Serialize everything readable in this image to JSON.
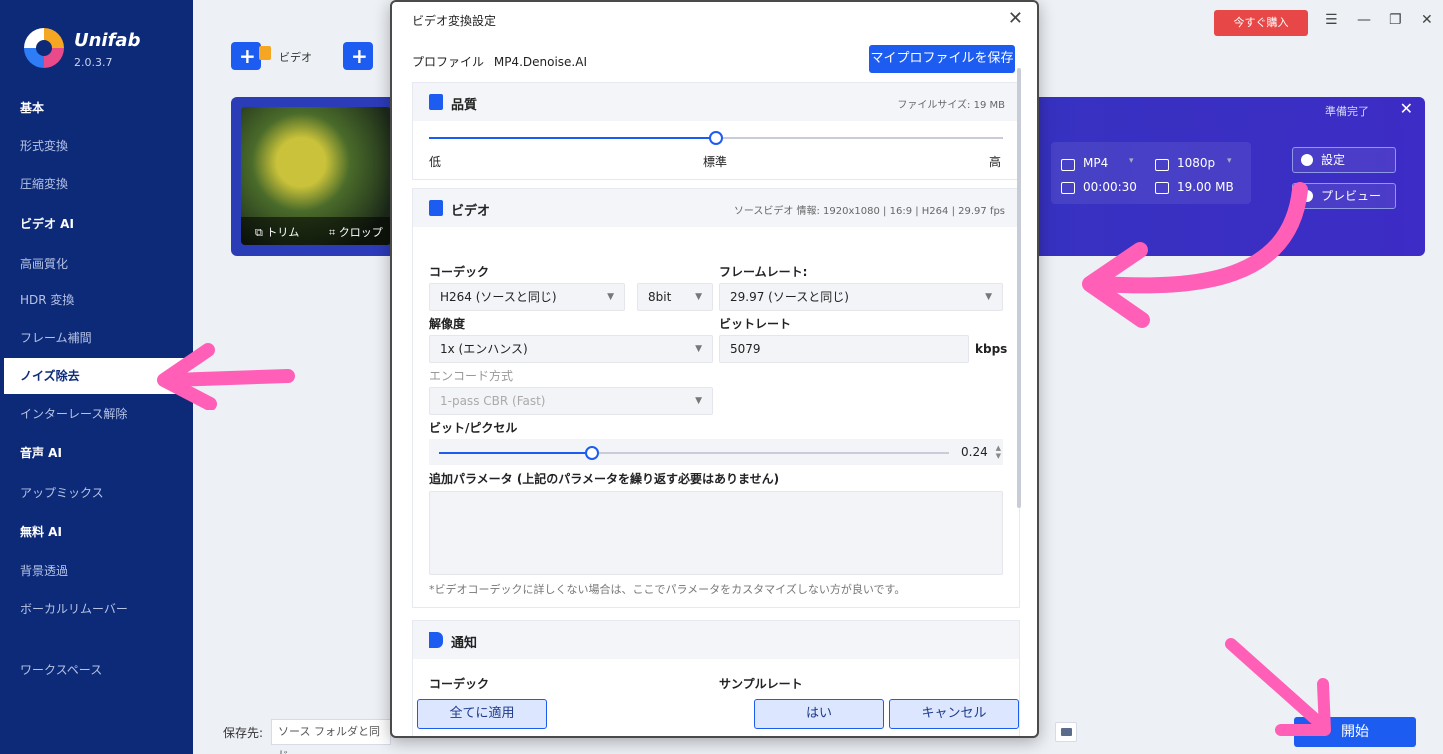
{
  "app": {
    "name": "Unifab",
    "version": "2.0.3.7"
  },
  "sidebar": {
    "items": [
      {
        "label": "基本",
        "kind": "header"
      },
      {
        "label": "形式変換",
        "kind": "item"
      },
      {
        "label": "圧縮変換",
        "kind": "item"
      },
      {
        "label": "ビデオ AI",
        "kind": "header"
      },
      {
        "label": "高画質化",
        "kind": "item"
      },
      {
        "label": "HDR 変換",
        "kind": "item"
      },
      {
        "label": "フレーム補間",
        "kind": "item"
      },
      {
        "label": "ノイズ除去",
        "kind": "active"
      },
      {
        "label": "インターレース解除",
        "kind": "item"
      },
      {
        "label": "音声 AI",
        "kind": "header"
      },
      {
        "label": "アップミックス",
        "kind": "item"
      },
      {
        "label": "無料 AI",
        "kind": "header"
      },
      {
        "label": "背景透過",
        "kind": "item"
      },
      {
        "label": "ボーカルリムーバー",
        "kind": "item"
      },
      {
        "label": "ワークスペース",
        "kind": "item"
      }
    ]
  },
  "toolbar": {
    "add_video_label": "ビデオ",
    "buy_label": "今すぐ購入"
  },
  "task": {
    "status": "準備完了",
    "trim_label": "トリム",
    "crop_label": "クロップ",
    "format": "MP4",
    "resolution": "1080p",
    "duration": "00:00:30",
    "size": "19.00 MB",
    "settings_label": "設定",
    "preview_label": "プレビュー"
  },
  "bottom": {
    "save_label": "保存先:",
    "save_path": "ソース フォルダと同じ",
    "start_label": "開始"
  },
  "dialog": {
    "title": "ビデオ変換設定",
    "profile_label": "プロファイル",
    "profile_value": "MP4.Denoise.AI",
    "save_profile_label": "マイプロファイルを保存",
    "quality": {
      "title": "品質",
      "file_size": "ファイルサイズ:  19 MB",
      "low": "低",
      "standard": "標準",
      "high": "高",
      "level": 0.5
    },
    "video": {
      "title": "ビデオ",
      "source_info": "ソースビデオ 情報: 1920x1080 | 16:9 | H264 | 29.97 fps",
      "codec_label": "コーデック",
      "codec_value": "H264 (ソースと同じ)",
      "bitdepth_value": "8bit",
      "framerate_label": "フレームレート:",
      "framerate_value": "29.97 (ソースと同じ)",
      "resolution_label": "解像度",
      "resolution_value": "1x (エンハンス)",
      "bitrate_label": "ビットレート",
      "bitrate_value": "5079",
      "bitrate_unit": "kbps",
      "encode_label": "エンコード方式",
      "encode_value": "1-pass CBR (Fast)",
      "bpp_label": "ビット/ピクセル",
      "bpp_value": "0.24",
      "bpp_level": 0.3,
      "extra_label": "追加パラメータ (上記のパラメータを繰り返す必要はありません)",
      "hint": "*ビデオコーデックに詳しくない場合は、ここでパラメータをカスタマイズしない方が良いです。"
    },
    "audio": {
      "title": "通知",
      "codec_label": "コーデック",
      "samplerate_label": "サンプルレート"
    },
    "apply_all_label": "全てに適用",
    "ok_label": "はい",
    "cancel_label": "キャンセル"
  },
  "colors": {
    "sidebar": "#0c2a78",
    "accent": "#1d5cf0",
    "buy": "#e84747",
    "annotation": "#ff5fb6"
  },
  "icons": [
    "search-icon",
    "close-icon",
    "menu-icon",
    "minimize-icon",
    "restore-icon",
    "settings-icon",
    "preview-icon",
    "folder-icon"
  ]
}
